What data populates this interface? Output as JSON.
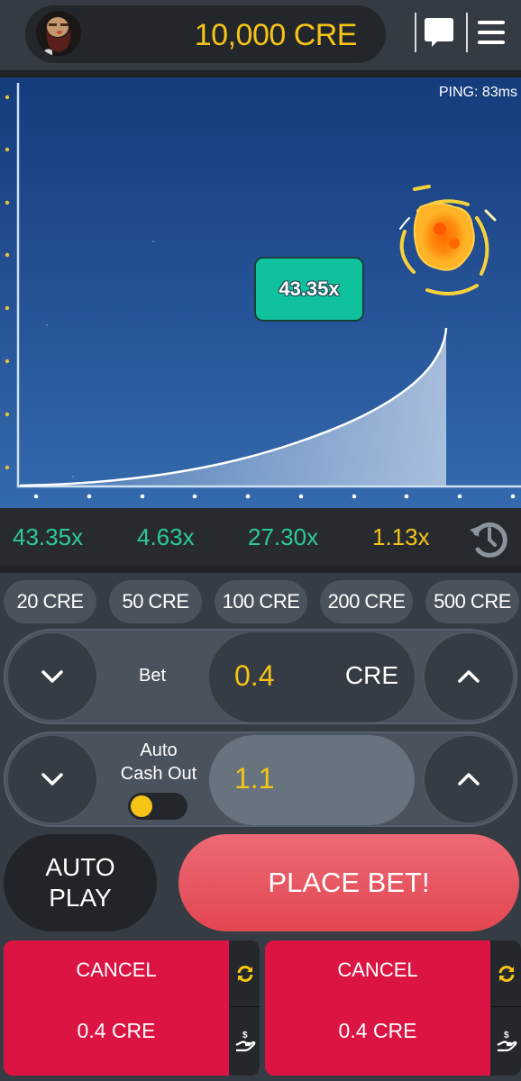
{
  "header": {
    "avatar": "bearded-warrior-avatar",
    "balance": "10,000 CRE",
    "icons": [
      "chat-icon",
      "menu-icon"
    ]
  },
  "game": {
    "ping": "PING: 83ms",
    "current_multiplier": "43.35x",
    "state": "crashed-explosion",
    "curve_fill_color": "#a9bedd"
  },
  "history": {
    "items": [
      {
        "value": "43.35x",
        "color": "#2ec99c"
      },
      {
        "value": "4.63x",
        "color": "#2ec99c"
      },
      {
        "value": "27.30x",
        "color": "#2ec99c"
      },
      {
        "value": "1.13x",
        "color": "#f6c416"
      }
    ],
    "icon": "history-icon"
  },
  "quick_bets": [
    "20 CRE",
    "50 CRE",
    "100 CRE",
    "200 CRE",
    "500 CRE"
  ],
  "bet": {
    "label": "Bet",
    "value": "0.4",
    "unit": "CRE"
  },
  "auto_cash_out": {
    "label_line1": "Auto",
    "label_line2": "Cash Out",
    "value": "1.1",
    "toggle_on": true
  },
  "buttons": {
    "autoplay_line1": "AUTO",
    "autoplay_line2": "PLAY",
    "place_bet": "PLACE BET!"
  },
  "active_bets": [
    {
      "label": "CANCEL",
      "amount": "0.4 CRE"
    },
    {
      "label": "CANCEL",
      "amount": "0.4 CRE"
    }
  ],
  "colors": {
    "accent_yellow": "#f6c416",
    "accent_green": "#2ec99c",
    "cancel_red": "#dc1444",
    "place_bet_red": "#e85560"
  }
}
